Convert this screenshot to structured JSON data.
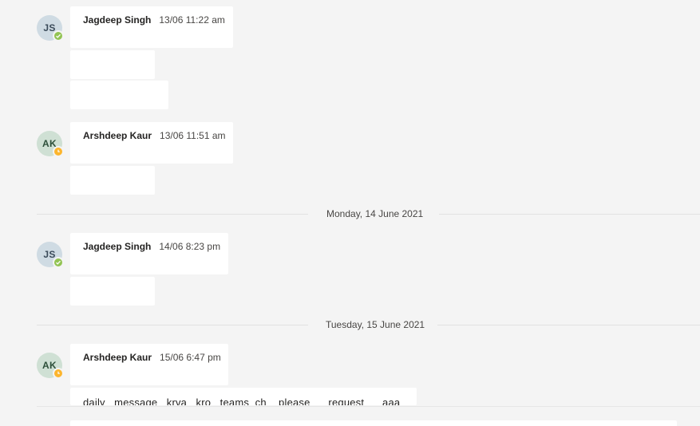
{
  "messages": [
    {
      "initials": "JS",
      "sender": "Jagdeep Singh",
      "time": "13/06 11:22 am",
      "presence": "available"
    },
    {
      "initials": "AK",
      "sender": "Arshdeep Kaur",
      "time": "13/06 11:51 am",
      "presence": "away"
    },
    {
      "initials": "JS",
      "sender": "Jagdeep Singh",
      "time": "14/06 8:23 pm",
      "presence": "available"
    },
    {
      "initials": "AK",
      "sender": "Arshdeep Kaur",
      "time": "15/06 6:47 pm",
      "presence": "away",
      "text": "daily   message   krva   kro   teams  ch    please      request      aaa"
    }
  ],
  "dividers": [
    {
      "label": "Monday, 14 June 2021"
    },
    {
      "label": "Tuesday, 15 June 2021"
    }
  ],
  "colors": {
    "background": "#f4f4f4",
    "bubble": "#ffffff",
    "presence_available": "#92c353",
    "presence_away": "#fcb52d"
  }
}
